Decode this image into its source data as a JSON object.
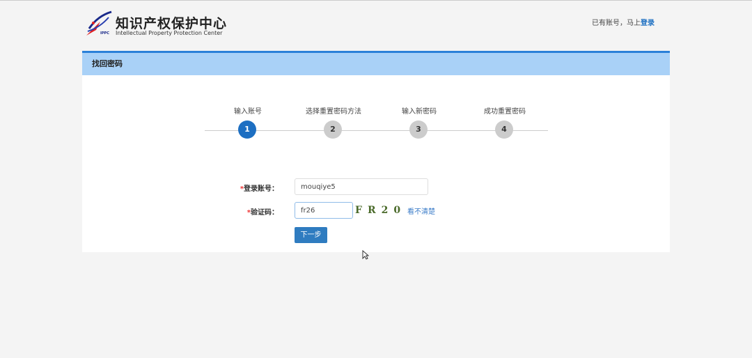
{
  "header": {
    "logo_cn": "知识产权保护中心",
    "logo_en": "Intellectual Property Protection Center",
    "logo_abbr": "IPPC",
    "login_prompt": "已有账号，马上",
    "login_link": "登录"
  },
  "panel": {
    "title": "找回密码"
  },
  "steps": [
    {
      "num": "1",
      "label": "输入账号"
    },
    {
      "num": "2",
      "label": "选择重置密码方法"
    },
    {
      "num": "3",
      "label": "输入新密码"
    },
    {
      "num": "4",
      "label": "成功重置密码"
    }
  ],
  "form": {
    "required_mark": "*",
    "account_label": "登录账号：",
    "account_value": "mouqiye5",
    "captcha_label": "验证码：",
    "captcha_value": "fr26",
    "captcha_image_text": "FR20",
    "refresh_link": "看不清楚",
    "next_button": "下一步"
  },
  "colors": {
    "accent": "#1d6fc2",
    "header_bg": "#a9d1f7"
  }
}
